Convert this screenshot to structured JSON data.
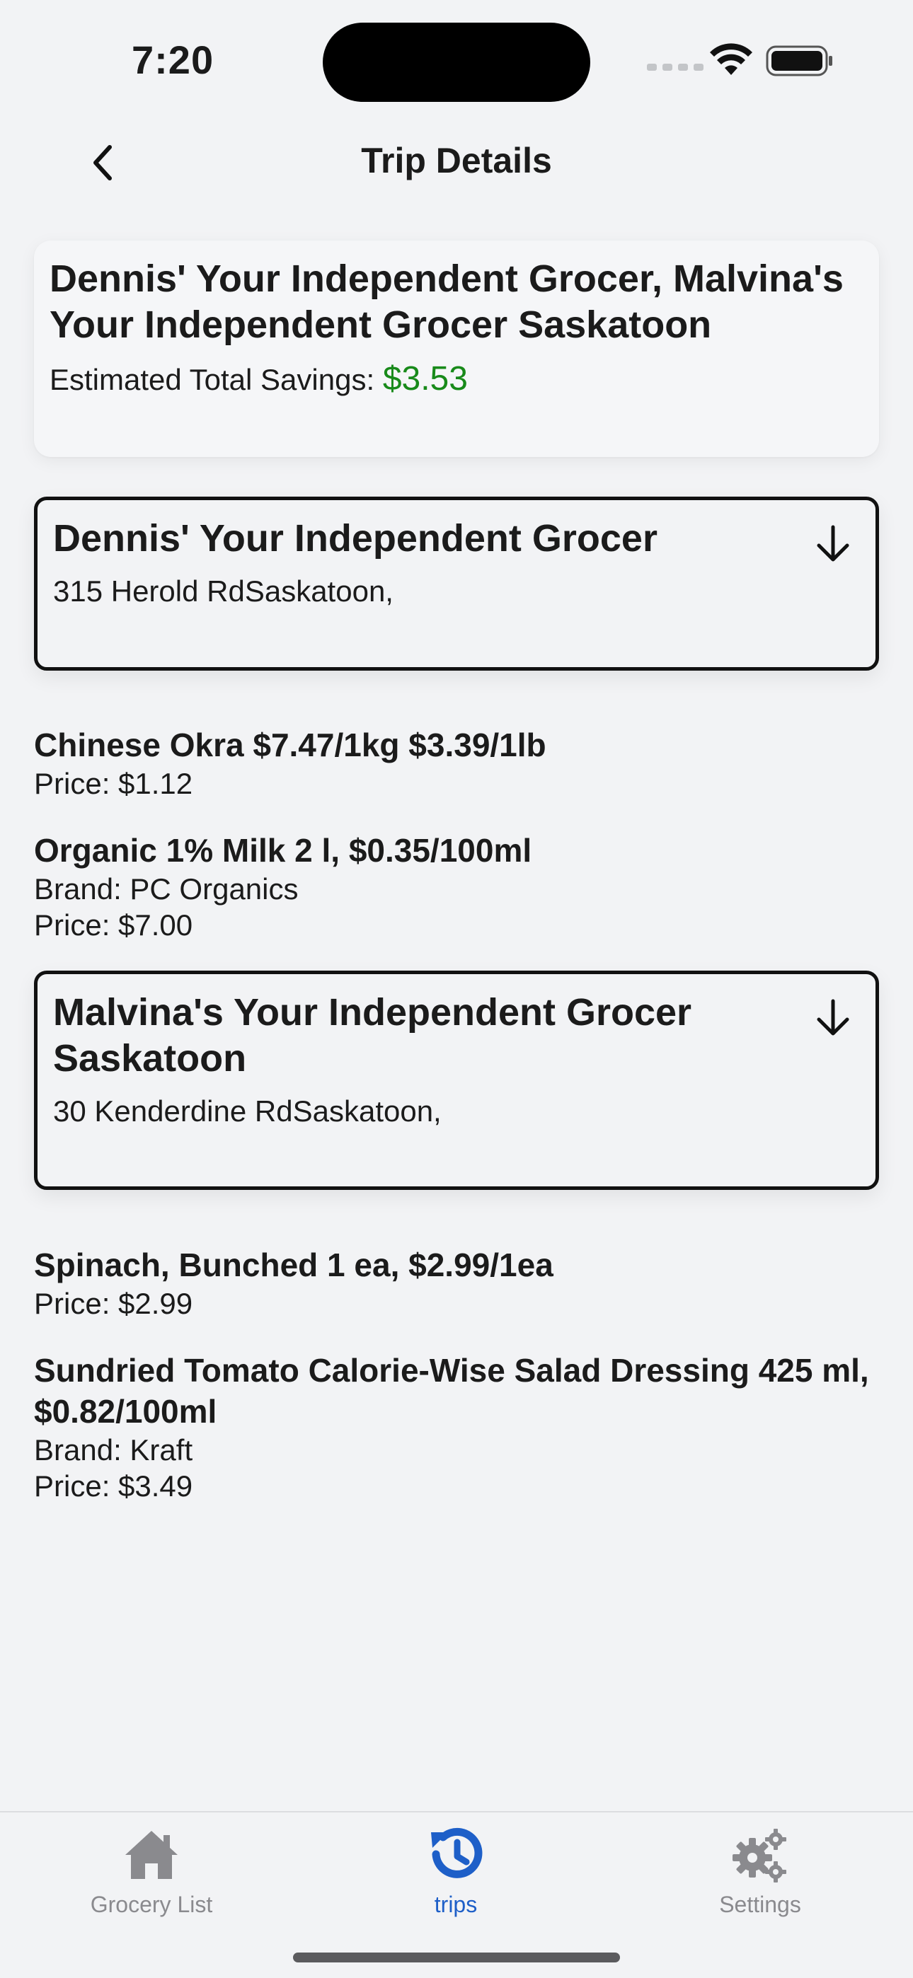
{
  "status_bar": {
    "time": "7:20"
  },
  "nav": {
    "title": "Trip Details",
    "back_icon": "chevron-left-icon"
  },
  "summary": {
    "title": "Dennis' Your Independent Grocer, Malvina's Your Independent Grocer Saskatoon",
    "savings_label": "Estimated Total Savings: ",
    "savings_value": "$3.53"
  },
  "stores": [
    {
      "name": "Dennis' Your Independent Grocer",
      "address": "315 Herold RdSaskatoon,",
      "items": [
        {
          "name": "Chinese Okra $7.47/1kg $3.39/1lb",
          "price": "Price: $1.12"
        },
        {
          "name": "Organic 1% Milk 2 l, $0.35/100ml",
          "brand": "Brand: PC Organics",
          "price": "Price: $7.00"
        }
      ]
    },
    {
      "name": "Malvina's Your Independent Grocer Saskatoon",
      "address": "30 Kenderdine RdSaskatoon,",
      "items": [
        {
          "name": "Spinach, Bunched 1 ea, $2.99/1ea",
          "price": "Price: $2.99"
        },
        {
          "name": "Sundried Tomato Calorie-Wise Salad Dressing 425 ml, $0.82/100ml",
          "brand": "Brand: Kraft",
          "price": "Price: $3.49"
        }
      ]
    }
  ],
  "tabs": [
    {
      "label": "Grocery List",
      "icon": "home-icon",
      "active": false
    },
    {
      "label": "trips",
      "icon": "history-icon",
      "active": true
    },
    {
      "label": "Settings",
      "icon": "gears-icon",
      "active": false
    }
  ],
  "colors": {
    "accent": "#1e5fc8",
    "savings": "#188a1a",
    "inactive_tab": "#8a8a8e"
  }
}
